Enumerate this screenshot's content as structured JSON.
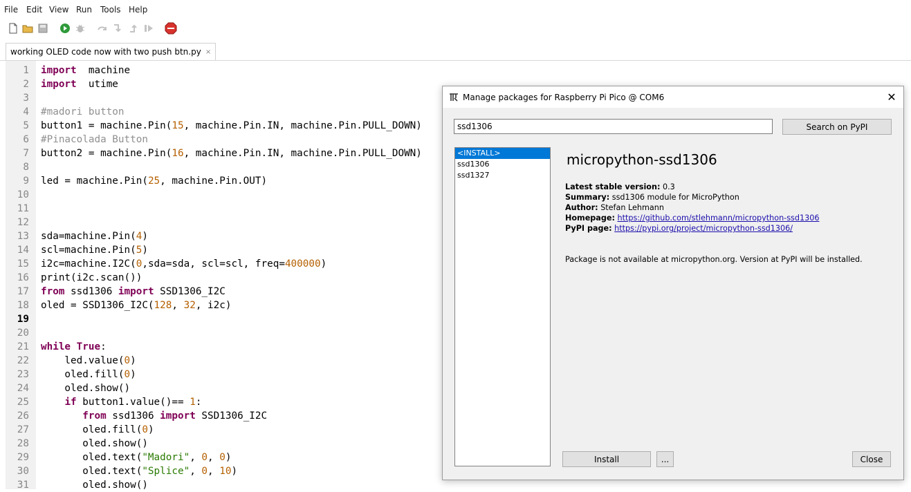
{
  "menu": [
    "File",
    "Edit",
    "View",
    "Run",
    "Tools",
    "Help"
  ],
  "tab": {
    "label": "working OLED code now with two push btn.py",
    "close": "×"
  },
  "current_line": 19,
  "code_lines": [
    [
      [
        "kw",
        "import"
      ],
      [
        "",
        "  machine"
      ]
    ],
    [
      [
        "kw",
        "import"
      ],
      [
        "",
        "  utime"
      ]
    ],
    [],
    [
      [
        "cmt",
        "#madori button"
      ]
    ],
    [
      [
        "",
        "button1 = machine.Pin("
      ],
      [
        "num",
        "15"
      ],
      [
        "",
        ", machine.Pin.IN, machine.Pin.PULL_DOWN)"
      ]
    ],
    [
      [
        "cmt",
        "#Pinacolada Button"
      ]
    ],
    [
      [
        "",
        "button2 = machine.Pin("
      ],
      [
        "num",
        "16"
      ],
      [
        "",
        ", machine.Pin.IN, machine.Pin.PULL_DOWN)"
      ]
    ],
    [],
    [
      [
        "",
        "led = machine.Pin("
      ],
      [
        "num",
        "25"
      ],
      [
        "",
        ", machine.Pin.OUT)"
      ]
    ],
    [],
    [],
    [],
    [
      [
        "",
        "sda=machine.Pin("
      ],
      [
        "num",
        "4"
      ],
      [
        "",
        ")"
      ]
    ],
    [
      [
        "",
        "scl=machine.Pin("
      ],
      [
        "num",
        "5"
      ],
      [
        "",
        ")"
      ]
    ],
    [
      [
        "",
        "i2c=machine.I2C("
      ],
      [
        "num",
        "0"
      ],
      [
        "",
        ",sda=sda, scl=scl, freq="
      ],
      [
        "num",
        "400000"
      ],
      [
        "",
        ")"
      ]
    ],
    [
      [
        "",
        "print(i2c.scan())"
      ]
    ],
    [
      [
        "kw",
        "from"
      ],
      [
        "",
        " ssd1306 "
      ],
      [
        "kw",
        "import"
      ],
      [
        "",
        " SSD1306_I2C"
      ]
    ],
    [
      [
        "",
        "oled = SSD1306_I2C("
      ],
      [
        "num",
        "128"
      ],
      [
        "",
        ", "
      ],
      [
        "num",
        "32"
      ],
      [
        "",
        ", i2c)"
      ]
    ],
    [],
    [],
    [
      [
        "kw",
        "while"
      ],
      [
        "",
        " "
      ],
      [
        "kw",
        "True"
      ],
      [
        "",
        ":"
      ]
    ],
    [
      [
        "",
        "    led.value("
      ],
      [
        "num",
        "0"
      ],
      [
        "",
        ")"
      ]
    ],
    [
      [
        "",
        "    oled.fill("
      ],
      [
        "num",
        "0"
      ],
      [
        "",
        ")"
      ]
    ],
    [
      [
        "",
        "    oled.show()"
      ]
    ],
    [
      [
        "",
        "    "
      ],
      [
        "kw",
        "if"
      ],
      [
        "",
        " button1.value()== "
      ],
      [
        "num",
        "1"
      ],
      [
        "",
        ":"
      ]
    ],
    [
      [
        "",
        "       "
      ],
      [
        "kw",
        "from"
      ],
      [
        "",
        " ssd1306 "
      ],
      [
        "kw",
        "import"
      ],
      [
        "",
        " SSD1306_I2C"
      ]
    ],
    [
      [
        "",
        "       oled.fill("
      ],
      [
        "num",
        "0"
      ],
      [
        "",
        ")"
      ]
    ],
    [
      [
        "",
        "       oled.show()"
      ]
    ],
    [
      [
        "",
        "       oled.text("
      ],
      [
        "str",
        "\"Madori\""
      ],
      [
        "",
        ", "
      ],
      [
        "num",
        "0"
      ],
      [
        "",
        ", "
      ],
      [
        "num",
        "0"
      ],
      [
        "",
        ")"
      ]
    ],
    [
      [
        "",
        "       oled.text("
      ],
      [
        "str",
        "\"Splice\""
      ],
      [
        "",
        ", "
      ],
      [
        "num",
        "0"
      ],
      [
        "",
        ", "
      ],
      [
        "num",
        "10"
      ],
      [
        "",
        ")"
      ]
    ],
    [
      [
        "",
        "       oled.show()"
      ]
    ]
  ],
  "dialog": {
    "title": "Manage packages for Raspberry Pi Pico @ COM6",
    "close_glyph": "✕",
    "search_value": "ssd1306",
    "search_button": "Search on PyPI",
    "list": [
      "<INSTALL>",
      "ssd1306",
      "ssd1327"
    ],
    "package_name": "micropython-ssd1306",
    "version_label": "Latest stable version:",
    "version": "0.3",
    "summary_label": "Summary:",
    "summary": "ssd1306 module for MicroPython",
    "author_label": "Author:",
    "author": "Stefan Lehmann",
    "homepage_label": "Homepage:",
    "homepage": "https://github.com/stlehmann/micropython-ssd1306",
    "pypi_label": "PyPI page:",
    "pypi": "https://pypi.org/project/micropython-ssd1306/",
    "note": "Package is not available at micropython.org. Version at PyPI will be installed.",
    "install_button": "Install",
    "more_button": "...",
    "close_button": "Close"
  }
}
